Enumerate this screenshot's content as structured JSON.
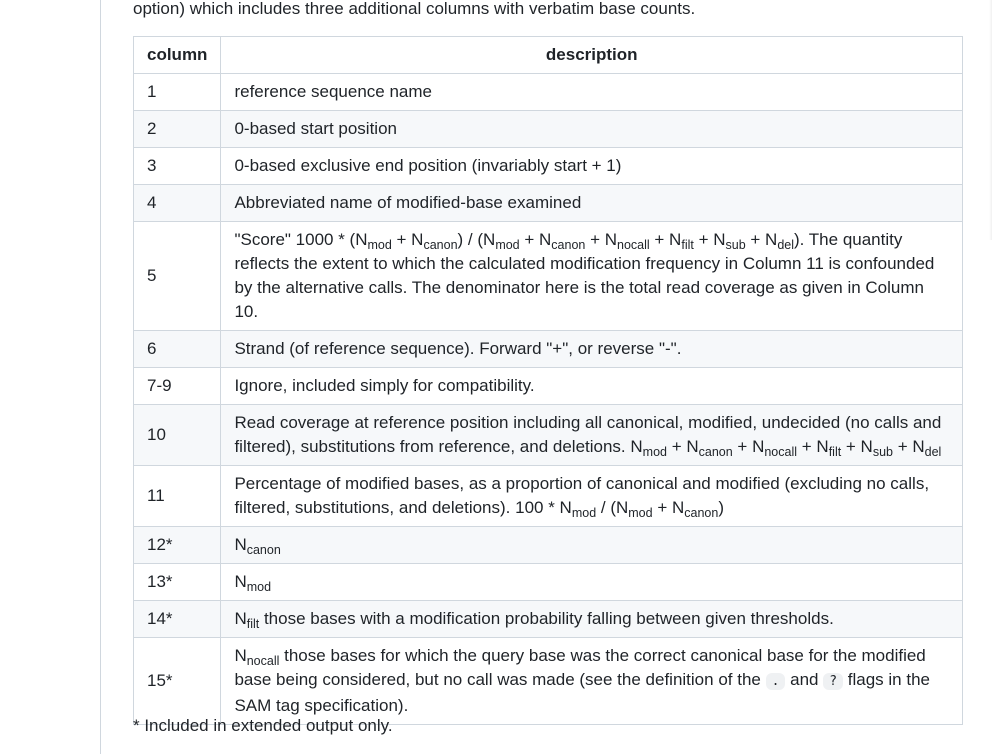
{
  "intro_text": "option) which includes three additional columns with verbatim base counts.",
  "table": {
    "headers": [
      "column",
      "description"
    ],
    "rows": [
      {
        "column": "1",
        "description": [
          {
            "t": "reference sequence name"
          }
        ]
      },
      {
        "column": "2",
        "description": [
          {
            "t": "0-based start position"
          }
        ]
      },
      {
        "column": "3",
        "description": [
          {
            "t": "0-based exclusive end position (invariably start + 1)"
          }
        ]
      },
      {
        "column": "4",
        "description": [
          {
            "t": "Abbreviated name of modified-base examined"
          }
        ]
      },
      {
        "column": "5",
        "description": [
          {
            "t": "\"Score\" 1000 * (N"
          },
          {
            "sub": "mod"
          },
          {
            "t": " + N"
          },
          {
            "sub": "canon"
          },
          {
            "t": ") / (N"
          },
          {
            "sub": "mod"
          },
          {
            "t": " + N"
          },
          {
            "sub": "canon"
          },
          {
            "t": " + N"
          },
          {
            "sub": "nocall"
          },
          {
            "t": " + N"
          },
          {
            "sub": "filt"
          },
          {
            "t": " + N"
          },
          {
            "sub": "sub"
          },
          {
            "t": " + N"
          },
          {
            "sub": "del"
          },
          {
            "t": "). The quantity reflects the extent to which the calculated modification frequency in Column 11 is confounded by the alternative calls. The denominator here is the total read coverage as given in Column 10."
          }
        ]
      },
      {
        "column": "6",
        "description": [
          {
            "t": "Strand (of reference sequence). Forward \"+\", or reverse \"-\"."
          }
        ]
      },
      {
        "column": "7-9",
        "description": [
          {
            "t": "Ignore, included simply for compatibility."
          }
        ]
      },
      {
        "column": "10",
        "description": [
          {
            "t": "Read coverage at reference position including all canonical, modified, undecided (no calls and filtered), substitutions from reference, and deletions. N"
          },
          {
            "sub": "mod"
          },
          {
            "t": " + N"
          },
          {
            "sub": "canon"
          },
          {
            "t": " + N"
          },
          {
            "sub": "nocall"
          },
          {
            "t": " + N"
          },
          {
            "sub": "filt"
          },
          {
            "t": " + N"
          },
          {
            "sub": "sub"
          },
          {
            "t": " + N"
          },
          {
            "sub": "del"
          }
        ]
      },
      {
        "column": "11",
        "description": [
          {
            "t": "Percentage of modified bases, as a proportion of canonical and modified (excluding no calls, filtered, substitutions, and deletions). 100 * N"
          },
          {
            "sub": "mod"
          },
          {
            "t": " / (N"
          },
          {
            "sub": "mod"
          },
          {
            "t": " + N"
          },
          {
            "sub": "canon"
          },
          {
            "t": ")"
          }
        ]
      },
      {
        "column": "12*",
        "description": [
          {
            "t": "N"
          },
          {
            "sub": "canon"
          }
        ]
      },
      {
        "column": "13*",
        "description": [
          {
            "t": "N"
          },
          {
            "sub": "mod"
          }
        ]
      },
      {
        "column": "14*",
        "description": [
          {
            "t": "N"
          },
          {
            "sub": "filt"
          },
          {
            "t": " those bases with a modification probability falling between given thresholds."
          }
        ]
      },
      {
        "column": "15*",
        "description": [
          {
            "t": "N"
          },
          {
            "sub": "nocall"
          },
          {
            "t": " those bases for which the query base was the correct canonical base for the modified base being considered, but no call was made (see the definition of the "
          },
          {
            "code": "."
          },
          {
            "t": " and "
          },
          {
            "code": "?"
          },
          {
            "t": " flags in the SAM tag specification)."
          }
        ]
      }
    ]
  },
  "footnote": "* Included in extended output only."
}
